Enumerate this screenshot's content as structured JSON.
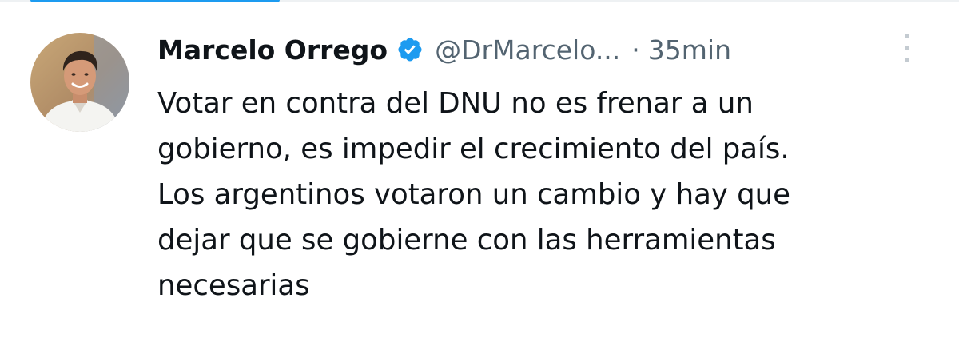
{
  "tweet": {
    "author_name": "Marcelo Orrego",
    "handle": "@DrMarcelo...",
    "separator": "·",
    "time": "35min",
    "text_lines": [
      "Votar en contra del DNU no es frenar a un",
      "gobierno, es impedir el crecimiento del país.",
      "Los argentinos votaron un cambio y hay que",
      "dejar que se gobierne con las herramientas",
      "necesarias"
    ]
  },
  "icons": {
    "verified": "verified-badge-icon",
    "more": "more-vertical-icon"
  },
  "colors": {
    "accent": "#1d9bf0",
    "text_primary": "#0f1419",
    "text_secondary": "#536471"
  }
}
